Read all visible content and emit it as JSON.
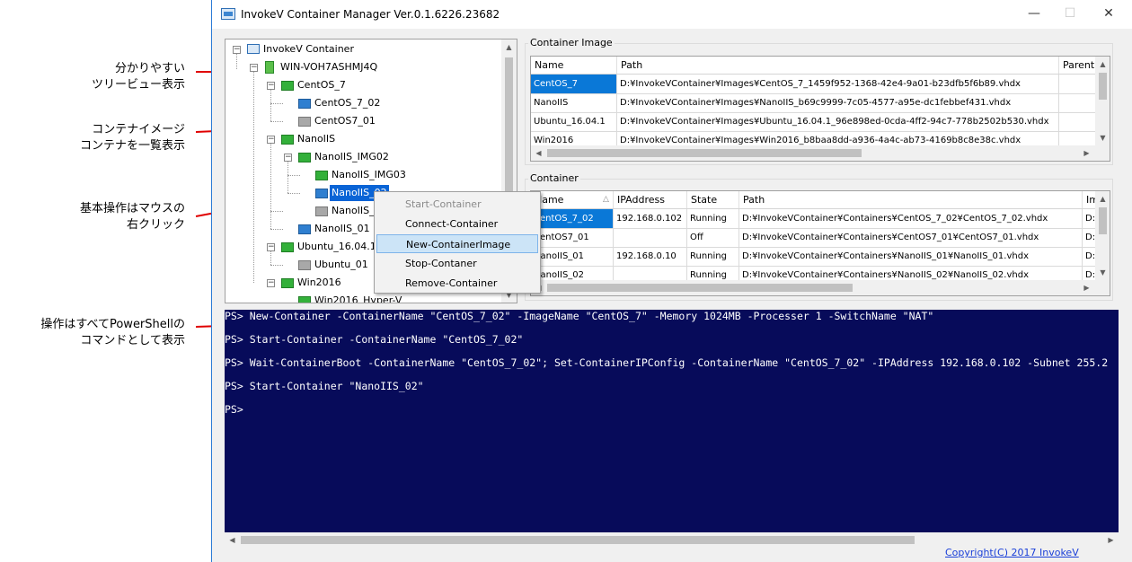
{
  "annotations": [
    {
      "line1": "分かりやすい",
      "line2": "ツリービュー表示"
    },
    {
      "line1": "コンテナイメージ",
      "line2": "コンテナを一覧表示"
    },
    {
      "line1": "基本操作はマウスの",
      "line2": "右クリック"
    },
    {
      "line1": "操作はすべてPowerShellの",
      "line2": "コマンドとして表示"
    }
  ],
  "window": {
    "title": "InvokeV Container Manager Ver.0.1.6226.23682",
    "minimize": "—",
    "maximize": "☐",
    "close": "✕"
  },
  "tree": {
    "nodes": [
      {
        "label": "InvokeV Container",
        "icon": "root-app-icon"
      },
      {
        "label": "WIN-VOH7ASHMJ4Q",
        "icon": "server-icon"
      },
      {
        "label": "CentOS_7",
        "icon": "container-image-icon"
      },
      {
        "label": "CentOS_7_02",
        "icon": "container-running-icon"
      },
      {
        "label": "CentOS7_01",
        "icon": "container-stopped-icon"
      },
      {
        "label": "NanoIIS",
        "icon": "container-image-icon"
      },
      {
        "label": "NanoIIS_IMG02",
        "icon": "container-image-icon"
      },
      {
        "label": "NanoIIS_IMG03",
        "icon": "container-image-icon"
      },
      {
        "label": "NanoIIS_02",
        "icon": "container-running-icon"
      },
      {
        "label": "NanoIIS_",
        "icon": "container-stopped-icon"
      },
      {
        "label": "NanoIIS_01",
        "icon": "container-running-icon"
      },
      {
        "label": "Ubuntu_16.04.1",
        "icon": "container-image-icon"
      },
      {
        "label": "Ubuntu_01",
        "icon": "container-stopped-icon"
      },
      {
        "label": "Win2016",
        "icon": "container-image-icon"
      },
      {
        "label": "Win2016_Hyper-V",
        "icon": "container-image-icon"
      }
    ]
  },
  "context_menu": {
    "items": [
      {
        "label": "Start-Container",
        "disabled": true
      },
      {
        "label": "Connect-Container",
        "disabled": false
      },
      {
        "label": "New-ContainerImage",
        "disabled": false,
        "hover": true
      },
      {
        "label": "Stop-Contaner",
        "disabled": false
      },
      {
        "label": "Remove-Container",
        "disabled": false
      }
    ]
  },
  "container_image": {
    "group_label": "Container Image",
    "headers": [
      "Name",
      "Path",
      "Parent"
    ],
    "rows": [
      [
        "CentOS_7",
        "D:¥InvokeVContainer¥Images¥CentOS_7_1459f952-1368-42e4-9a01-b23dfb5f6b89.vhdx",
        ""
      ],
      [
        "NanoIIS",
        "D:¥InvokeVContainer¥Images¥NanoIIS_b69c9999-7c05-4577-a95e-dc1febbef431.vhdx",
        ""
      ],
      [
        "Ubuntu_16.04.1",
        "D:¥InvokeVContainer¥Images¥Ubuntu_16.04.1_96e898ed-0cda-4ff2-94c7-778b2502b530.vhdx",
        ""
      ],
      [
        "Win2016",
        "D:¥InvokeVContainer¥Images¥Win2016_b8baa8dd-a936-4a4c-ab73-4169b8c8e38c.vhdx",
        ""
      ]
    ]
  },
  "container": {
    "group_label": "Container",
    "headers": [
      "Name",
      "IPAddress",
      "State",
      "Path",
      "Im"
    ],
    "rows": [
      [
        "CentOS_7_02",
        "192.168.0.102",
        "Running",
        "D:¥InvokeVContainer¥Containers¥CentOS_7_02¥CentOS_7_02.vhdx",
        "D:¥"
      ],
      [
        "CentOS7_01",
        "",
        "Off",
        "D:¥InvokeVContainer¥Containers¥CentOS7_01¥CentOS7_01.vhdx",
        "D:¥"
      ],
      [
        "NanoIIS_01",
        "192.168.0.10",
        "Running",
        "D:¥InvokeVContainer¥Containers¥NanoIIS_01¥NanoIIS_01.vhdx",
        "D:¥"
      ],
      [
        "NanoIIS_02",
        "",
        "Running",
        "D:¥InvokeVContainer¥Containers¥NanoIIS_02¥NanoIIS_02.vhdx",
        "D:¥"
      ]
    ]
  },
  "console": {
    "lines": [
      "PS> New-Container -ContainerName \"CentOS_7_02\" -ImageName \"CentOS_7\" -Memory 1024MB -Processer 1 -SwitchName \"NAT\"",
      "PS> Start-Container -ContainerName \"CentOS_7_02\"",
      "PS> Wait-ContainerBoot -ContainerName \"CentOS_7_02\"; Set-ContainerIPConfig -ContainerName \"CentOS_7_02\" -IPAddress 192.168.0.102 -Subnet 255.2",
      "PS> Start-Container \"NanoIIS_02\"",
      "PS>"
    ]
  },
  "footer": {
    "copyright": "Copyright(C) 2017 InvokeV"
  }
}
